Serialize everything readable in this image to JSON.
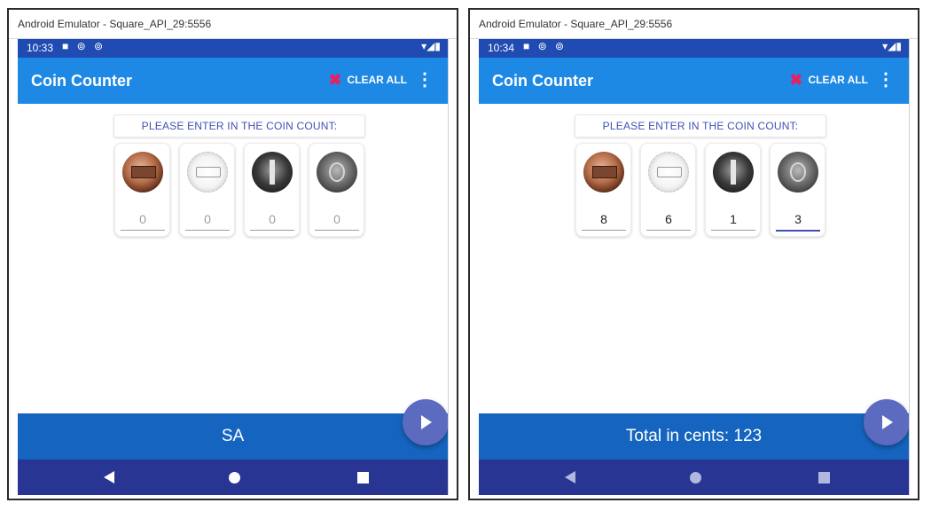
{
  "screens": [
    {
      "window_title": "Android Emulator - Square_API_29:5556",
      "status_time": "10:33",
      "status_left_icons": "■ ⊚ ⊚",
      "status_right_icons": "▾◢▮",
      "app_title": "Coin Counter",
      "clear_all_label": "CLEAR ALL",
      "menu_icon": "⋮",
      "prompt": "PLEASE ENTER IN THE COIN COUNT:",
      "coins": [
        {
          "icon": "penny-icon",
          "value": "",
          "placeholder": "0"
        },
        {
          "icon": "nickel-icon",
          "value": "",
          "placeholder": "0"
        },
        {
          "icon": "dime-icon",
          "value": "",
          "placeholder": "0"
        },
        {
          "icon": "quarter-icon",
          "value": "",
          "placeholder": "0"
        }
      ],
      "result_text": "SA",
      "fab_icon": "play-icon"
    },
    {
      "window_title": "Android Emulator - Square_API_29:5556",
      "status_time": "10:34",
      "status_left_icons": "■ ⊚ ⊚",
      "status_right_icons": "▾◢▮",
      "app_title": "Coin Counter",
      "clear_all_label": "CLEAR ALL",
      "menu_icon": "⋮",
      "prompt": "PLEASE ENTER IN THE COIN COUNT:",
      "coins": [
        {
          "icon": "penny-icon",
          "value": "8",
          "placeholder": "0"
        },
        {
          "icon": "nickel-icon",
          "value": "6",
          "placeholder": "0"
        },
        {
          "icon": "dime-icon",
          "value": "1",
          "placeholder": "0"
        },
        {
          "icon": "quarter-icon",
          "value": "3",
          "placeholder": "0"
        }
      ],
      "result_text": "Total in cents: 123",
      "fab_icon": "play-icon"
    }
  ],
  "colors": {
    "status_bar": "#1f4bb3",
    "app_bar": "#1e88e5",
    "clear_icon": "#e91e63",
    "prompt_text": "#3f51b5",
    "result_bar": "#1565c0",
    "fab": "#5c6bc0",
    "nav_bar": "#283593"
  }
}
